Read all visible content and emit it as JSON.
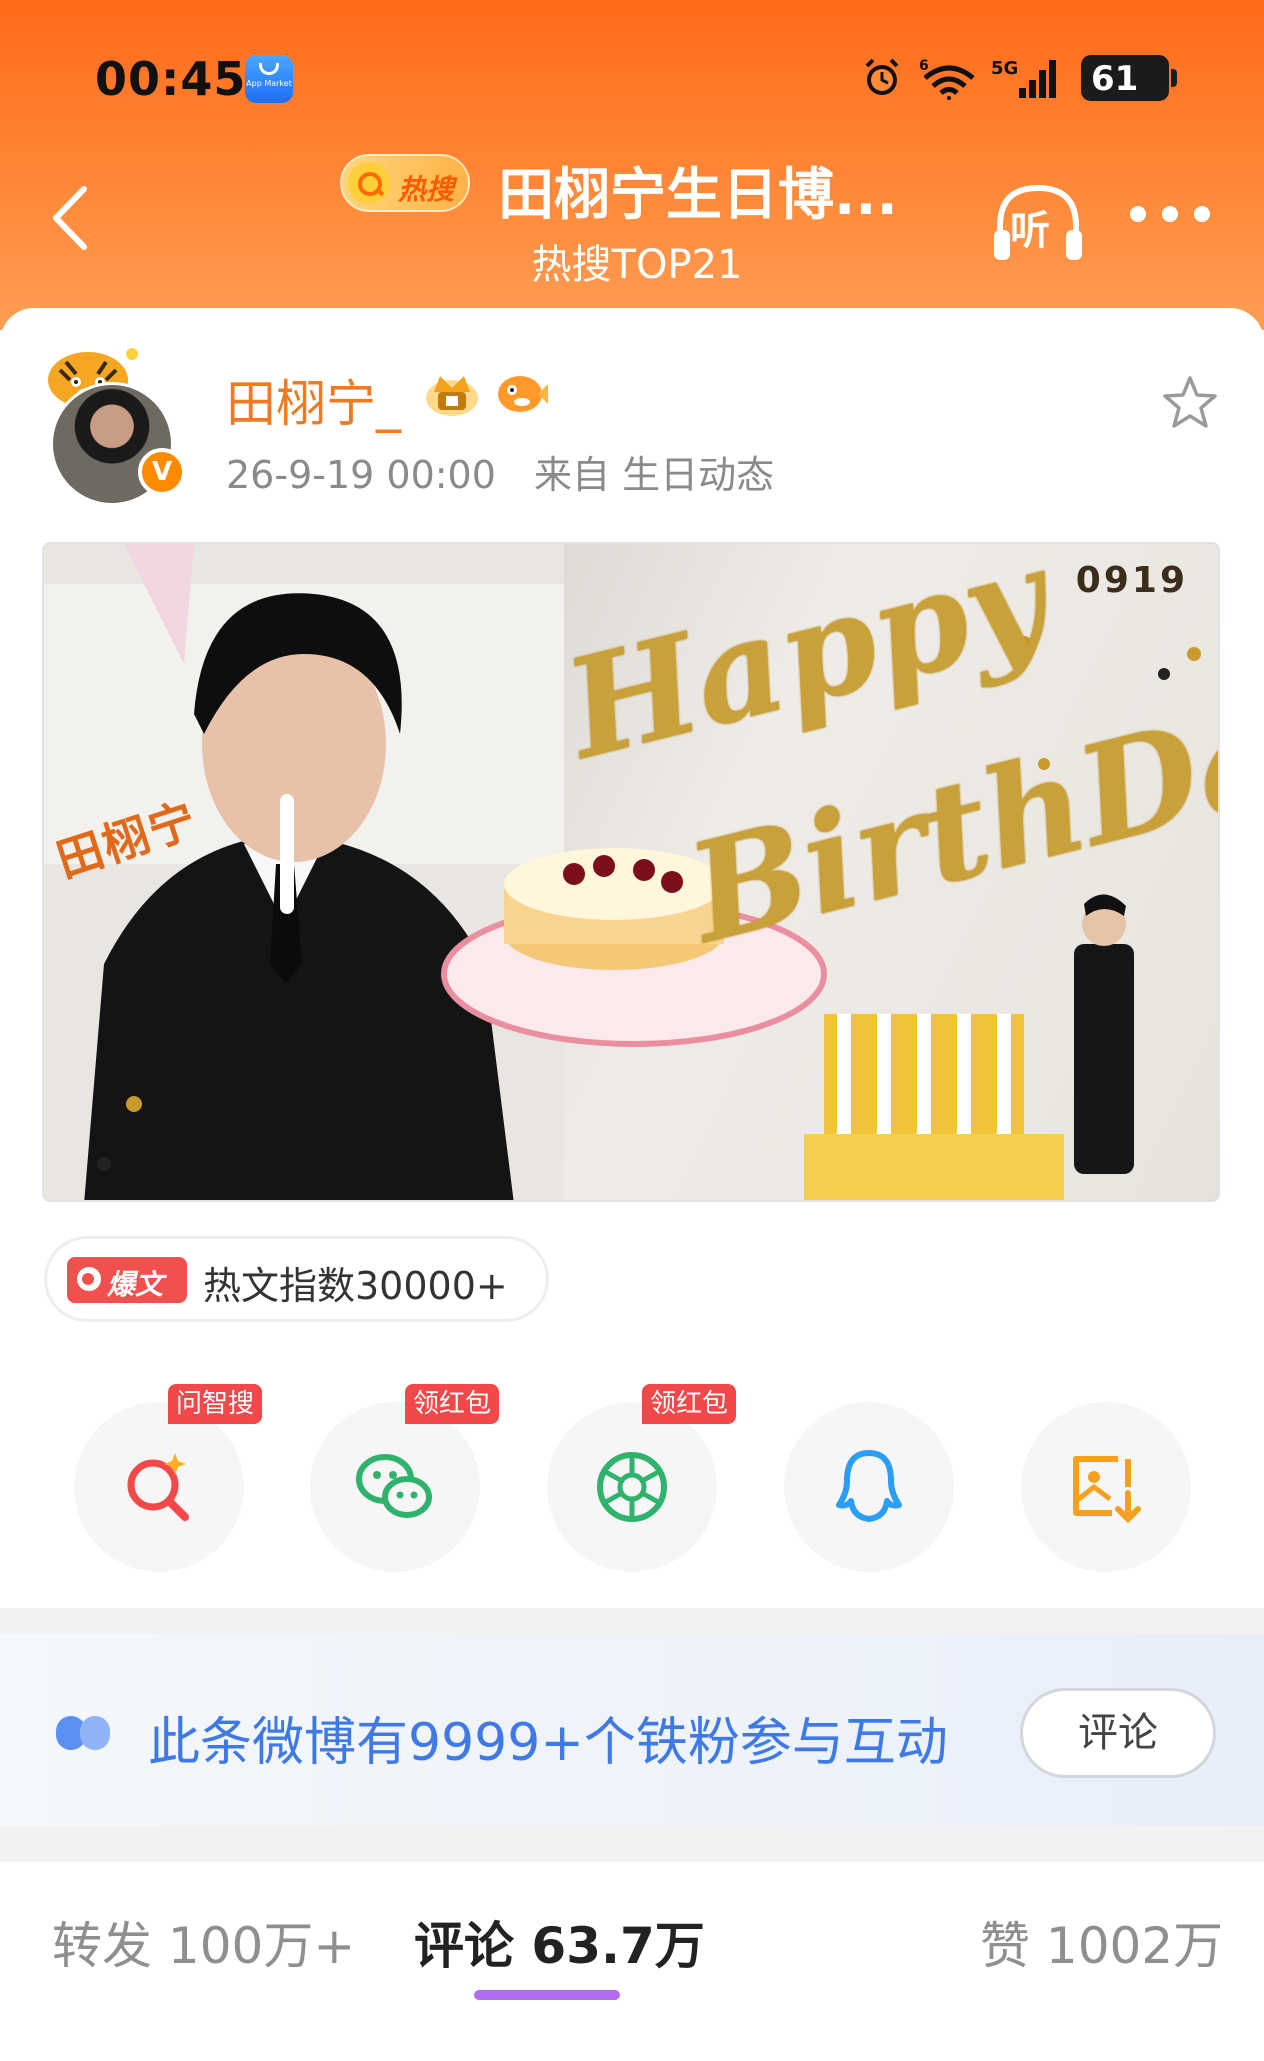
{
  "status_bar": {
    "time": "00:45",
    "app_badge_text": "App Market",
    "network": "5G",
    "wifi_label": "6",
    "battery": "61"
  },
  "nav": {
    "hot_badge": "热搜",
    "title": "田栩宁生日博...",
    "subtitle": "热搜TOP21",
    "listen_label": "听"
  },
  "post": {
    "user_name": "田栩宁_",
    "verified_mark": "V",
    "time": "26-9-19 00:00",
    "source": "来自 生日动态",
    "image": {
      "date_tag": "0919",
      "headline_1": "Happy",
      "headline_2": "BirthDay",
      "name_stamp": "田栩宁"
    },
    "hot_article": {
      "badge": "爆文",
      "text": "热文指数30000+"
    }
  },
  "share": {
    "items": [
      {
        "name": "问智搜",
        "tag": "问智搜"
      },
      {
        "name": "微信",
        "tag": "领红包"
      },
      {
        "name": "朋友圈",
        "tag": "领红包"
      },
      {
        "name": "QQ",
        "tag": ""
      },
      {
        "name": "保存图片",
        "tag": ""
      }
    ]
  },
  "fans_banner": {
    "text": "此条微博有9999+个铁粉参与互动",
    "button": "评论"
  },
  "tabs": {
    "repost": "转发 100万+",
    "comment": "评论 63.7万",
    "like": "赞 1002万"
  },
  "colors": {
    "header_orange": "#ff6a1a",
    "username_orange": "#f07a22",
    "link_blue": "#3f79e6",
    "tab_indicator": "#b06cf1",
    "hot_red": "#f0514e"
  }
}
